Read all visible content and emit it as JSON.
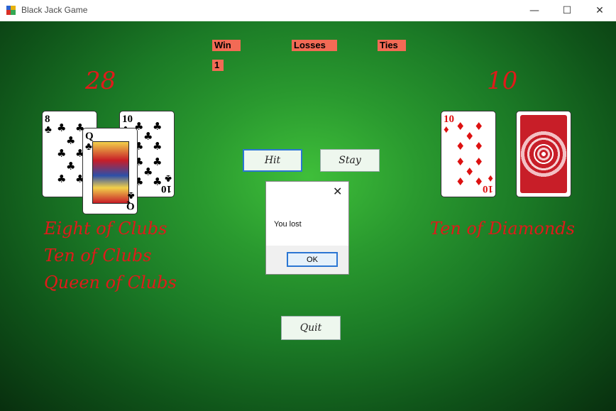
{
  "window": {
    "title": "Black Jack Game",
    "controls": {
      "minimize": "—",
      "maximize": "☐",
      "close": "✕"
    }
  },
  "stats": {
    "win_label": "Win",
    "losses_label": "Losses",
    "ties_label": "Ties",
    "wins_value": "1"
  },
  "player": {
    "score": "28",
    "cards": [
      {
        "rank": "8",
        "suit": "♣",
        "name": "Eight of Clubs"
      },
      {
        "rank": "10",
        "suit": "♣",
        "name": "Ten of Clubs"
      },
      {
        "rank": "Q",
        "suit": "♣",
        "name": "Queen of Clubs"
      }
    ]
  },
  "dealer": {
    "score": "10",
    "cards": [
      {
        "rank": "10",
        "suit": "♦",
        "name": "Ten of Diamonds"
      },
      {
        "rank": "",
        "suit": "",
        "name": "face-down"
      }
    ]
  },
  "buttons": {
    "hit": "Hit",
    "stay": "Stay",
    "quit": "Quit"
  },
  "dialog": {
    "message": "You lost",
    "ok": "OK",
    "close": "✕"
  },
  "colors": {
    "felt": "#1b7a26",
    "label_bg": "#f26a55",
    "score_text": "#e01a1a"
  }
}
